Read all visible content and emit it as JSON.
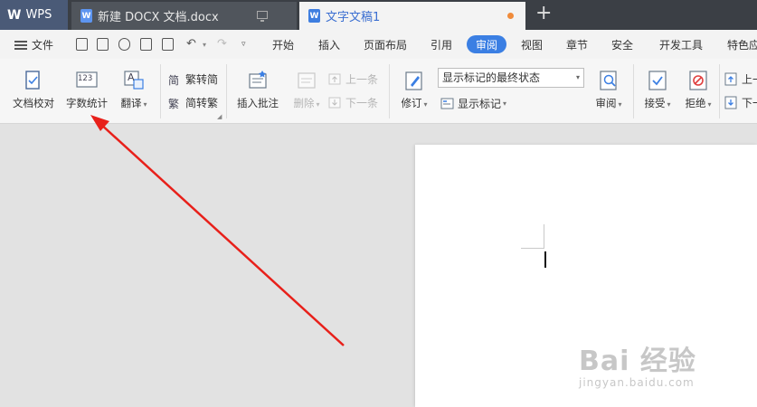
{
  "tabs": {
    "app_label": "WPS",
    "doc1": "新建 DOCX 文档.docx",
    "doc2": "文字文稿1",
    "doc_icon_letter": "W",
    "new_tab": "+"
  },
  "menu": {
    "file": "文件",
    "items": [
      "开始",
      "插入",
      "页面布局",
      "引用",
      "审阅",
      "视图",
      "章节",
      "安全",
      "开发工具",
      "特色应"
    ],
    "active": "审阅"
  },
  "ribbon": {
    "proofread": "文档校对",
    "word_count": "字数统计",
    "translate": "翻译",
    "trad_to_simp": "繁转简",
    "simp_to_trad": "简转繁",
    "insert_comment": "插入批注",
    "delete": "删除",
    "prev": "上一条",
    "next": "下一条",
    "revise": "修订",
    "markup_state": "显示标记的最终状态",
    "show_markup": "显示标记",
    "review": "审阅",
    "accept": "接受",
    "reject": "拒绝",
    "up": "上一",
    "down": "下一",
    "ico_123": "123",
    "ico_a": "A",
    "ico_jian": "简",
    "ico_fan": "繁"
  },
  "watermark": {
    "big": "Bai 经验",
    "small": "jingyan.baidu.com"
  },
  "colors": {
    "accent": "#3b7fe3",
    "annotation": "#e8201a"
  }
}
